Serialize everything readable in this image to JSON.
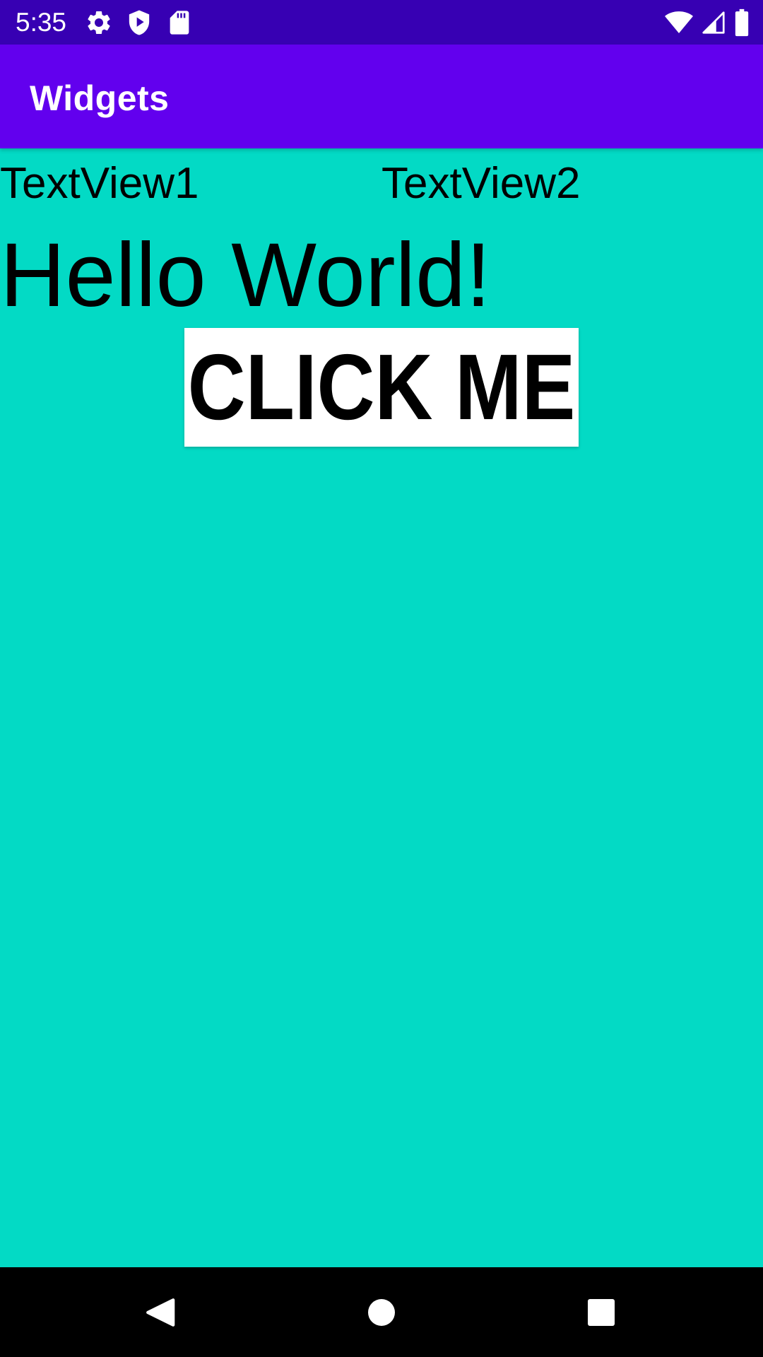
{
  "status_bar": {
    "time": "5:35",
    "background": "#3700B3",
    "left_icons": [
      "gear-icon",
      "play-protect-icon",
      "sd-card-icon"
    ],
    "right_icons": [
      "wifi-icon",
      "cellular-signal-icon",
      "battery-icon"
    ]
  },
  "app_bar": {
    "title": "Widgets",
    "background": "#6200EE"
  },
  "content": {
    "background": "#03DAC5",
    "textview1": "TextView1",
    "textview2": "TextView2",
    "hello_text": "Hello World!",
    "button_label": "CLICK ME"
  },
  "nav_bar": {
    "background": "#000000",
    "buttons": [
      "back-icon",
      "home-icon",
      "recents-icon"
    ]
  }
}
